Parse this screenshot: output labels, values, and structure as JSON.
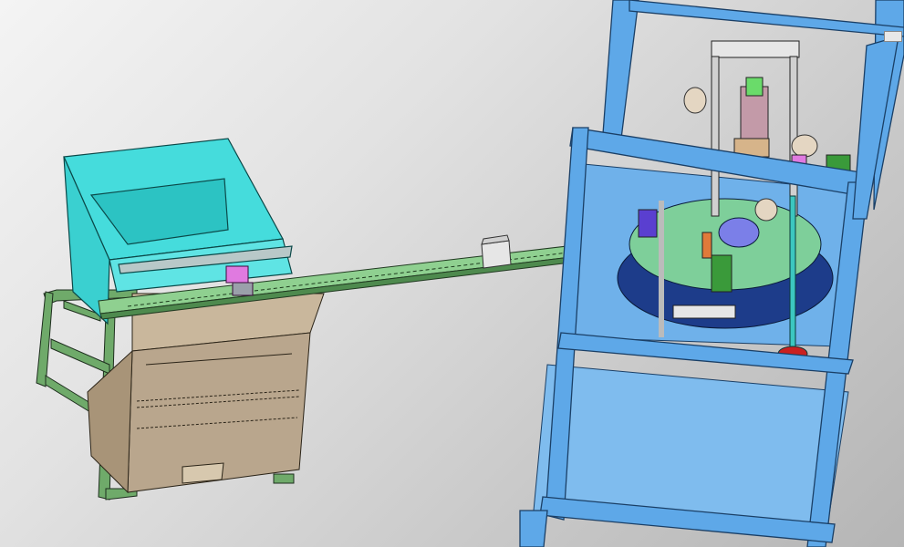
{
  "scene": {
    "kind": "cad-render",
    "colors": {
      "frame_blue": "#5ea8e8",
      "frame_edge": "#1a3f66",
      "panel_blue": "#79b9ee",
      "hopper_cyan": "#3fd6d6",
      "extrusion_green": "#6faa6a",
      "enclosure_tan": "#b9a68d",
      "conveyor_rail": "#8fd090",
      "table_green": "#7ecf9a",
      "table_base_navy": "#1d3c8a",
      "post_teal": "#3cc7c0"
    }
  }
}
